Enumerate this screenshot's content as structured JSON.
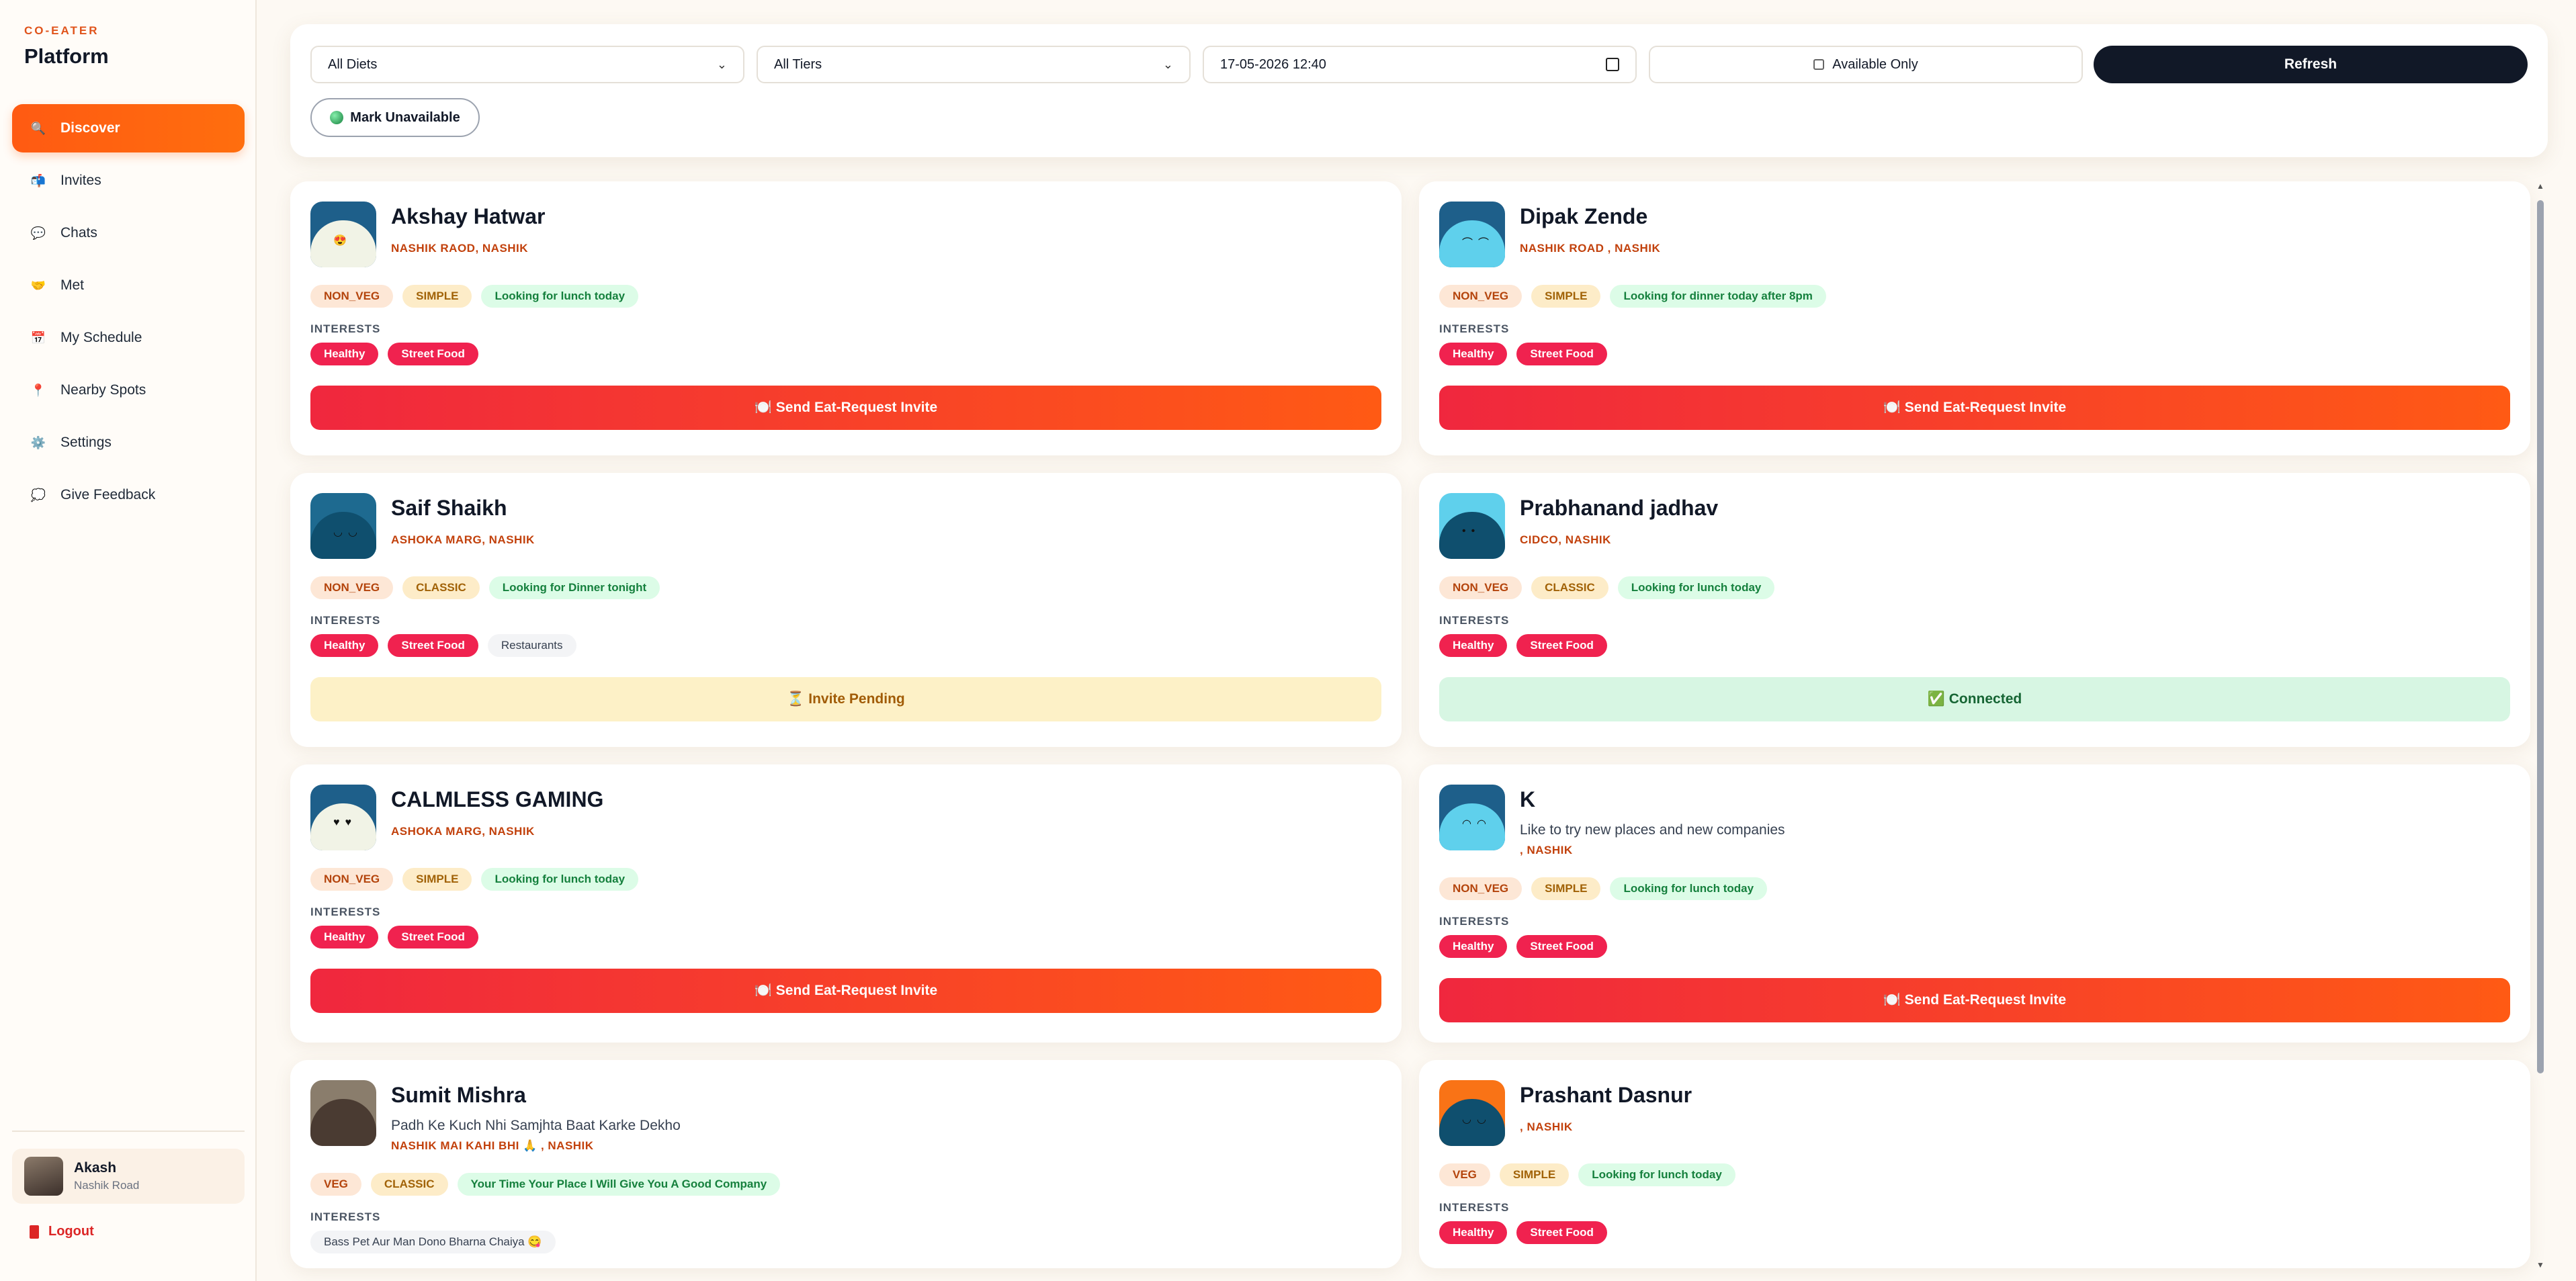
{
  "brand": {
    "small": "CO-EATER",
    "big": "Platform"
  },
  "nav": [
    {
      "label": "Discover",
      "icon": "search-icon",
      "glyph": "🔍"
    },
    {
      "label": "Invites",
      "icon": "mail-icon",
      "glyph": "📬"
    },
    {
      "label": "Chats",
      "icon": "chat-icon",
      "glyph": "💬"
    },
    {
      "label": "Met",
      "icon": "handshake-icon",
      "glyph": "🤝"
    },
    {
      "label": "My Schedule",
      "icon": "calendar-icon",
      "glyph": "📅"
    },
    {
      "label": "Nearby Spots",
      "icon": "pin-icon",
      "glyph": "📍"
    },
    {
      "label": "Settings",
      "icon": "gear-icon",
      "glyph": "⚙️"
    },
    {
      "label": "Give Feedback",
      "icon": "feedback-icon",
      "glyph": "💭"
    }
  ],
  "user": {
    "name": "Akash",
    "location": "Nashik Road"
  },
  "logout": "Logout",
  "filters": {
    "diet": "All Diets",
    "tier": "All Tiers",
    "datetime": "17-05-2026 12:40",
    "available": "Available Only",
    "refresh": "Refresh",
    "mark": "Mark Unavailable"
  },
  "labels": {
    "interests": "INTERESTS"
  },
  "cards": [
    {
      "name": "Akshay Hatwar",
      "bio": "",
      "location": "NASHIK RAOD, NASHIK",
      "diet": "NON_VEG",
      "tier": "SIMPLE",
      "status": "Looking for lunch today",
      "interests": [
        "Healthy",
        "Street Food"
      ],
      "action": "🍽️ Send Eat-Request Invite",
      "action_type": "invite",
      "avatar_bg": "#1e5f8a",
      "face": "#f1f3e6",
      "eyes": "😍"
    },
    {
      "name": "Dipak Zende",
      "bio": "",
      "location": "NASHIK ROAD , NASHIK",
      "diet": "NON_VEG",
      "tier": "SIMPLE",
      "status": "Looking for dinner today after 8pm",
      "interests": [
        "Healthy",
        "Street Food"
      ],
      "action": "🍽️ Send Eat-Request Invite",
      "action_type": "invite",
      "avatar_bg": "#1e5f8a",
      "face": "#5fd0ec",
      "eyes": "⌒⌒"
    },
    {
      "name": "Saif Shaikh",
      "bio": "",
      "location": "ASHOKA MARG, NASHIK",
      "diet": "NON_VEG",
      "tier": "CLASSIC",
      "status": "Looking for Dinner tonight",
      "interests": [
        "Healthy",
        "Street Food"
      ],
      "interests_plain": [
        "Restaurants"
      ],
      "action": "⏳ Invite Pending",
      "action_type": "pending",
      "avatar_bg": "#1e6a90",
      "face": "#0f4f6e",
      "eyes": "◡◡"
    },
    {
      "name": "Prabhanand jadhav",
      "bio": "",
      "location": "CIDCO, NASHIK",
      "diet": "NON_VEG",
      "tier": "CLASSIC",
      "status": "Looking for lunch today",
      "interests": [
        "Healthy",
        "Street Food"
      ],
      "action": "✅ Connected",
      "action_type": "connected",
      "avatar_bg": "#5fd0ec",
      "face": "#0f4f6e",
      "eyes": "••"
    },
    {
      "name": "CALMLESS GAMING",
      "bio": "",
      "location": "ASHOKA MARG, NASHIK",
      "diet": "NON_VEG",
      "tier": "SIMPLE",
      "status": "Looking for lunch today",
      "interests": [
        "Healthy",
        "Street Food"
      ],
      "action": "🍽️ Send Eat-Request Invite",
      "action_type": "invite",
      "avatar_bg": "#1e5f8a",
      "face": "#f1f3e6",
      "eyes": "♥♥"
    },
    {
      "name": "K",
      "bio": "Like to try new places and new companies",
      "location": ", NASHIK",
      "diet": "NON_VEG",
      "tier": "SIMPLE",
      "status": "Looking for lunch today",
      "interests": [
        "Healthy",
        "Street Food"
      ],
      "action": "🍽️ Send Eat-Request Invite",
      "action_type": "invite",
      "avatar_bg": "#1e5f8a",
      "face": "#5fd0ec",
      "eyes": "◠◠"
    },
    {
      "name": "Sumit Mishra",
      "bio": "Padh Ke Kuch Nhi Samjhta Baat Karke Dekho",
      "location": "NASHIK MAI KAHI BHI 🙏 , NASHIK",
      "diet": "VEG",
      "tier": "CLASSIC",
      "status": "Your Time Your Place I Will Give You A Good Company",
      "interests": [],
      "interests_plain": [
        "Bass Pet Aur Man Dono Bharna Chaiya 😋"
      ],
      "action": "",
      "action_type": "none",
      "avatar_bg": "#8a7d6c",
      "face": "#4a3b32",
      "eyes": ""
    },
    {
      "name": "Prashant Dasnur",
      "bio": "",
      "location": ", NASHIK",
      "diet": "VEG",
      "tier": "SIMPLE",
      "status": "Looking for lunch today",
      "interests": [
        "Healthy",
        "Street Food"
      ],
      "action": "",
      "action_type": "none",
      "avatar_bg": "#f97316",
      "face": "#0f4f6e",
      "eyes": "◡◡"
    }
  ]
}
